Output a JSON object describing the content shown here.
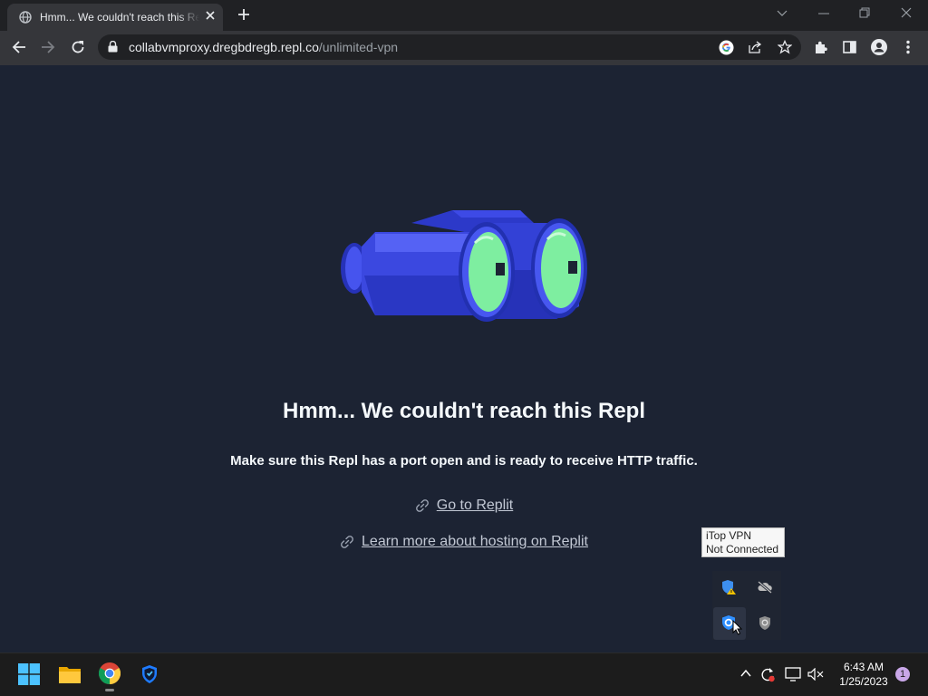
{
  "browser": {
    "tab": {
      "title": "Hmm... We couldn't reach this Repl",
      "favicon": "globe-icon",
      "close_icon": "close-icon"
    },
    "new_tab_icon": "plus-icon",
    "window_controls": [
      "chevron-down-icon",
      "minimize-icon",
      "restore-icon",
      "close-icon"
    ],
    "nav": [
      "back-arrow-icon",
      "forward-arrow-icon",
      "reload-icon"
    ],
    "address": {
      "host": "collabvmproxy.dregbdregb.repl.co",
      "path": "/unlimited-vpn",
      "lock_icon": "lock-icon"
    },
    "address_actions": [
      "google-icon",
      "share-icon",
      "star-icon"
    ],
    "toolbar_actions": [
      "extensions-puzzle-icon",
      "side-panel-icon",
      "profile-icon",
      "kebab-menu-icon"
    ]
  },
  "page": {
    "illustration": "binoculars-illustration",
    "heading": "Hmm... We couldn't reach this Repl",
    "subtitle": "Make sure this Repl has a port open and is ready to receive HTTP traffic.",
    "links": [
      {
        "label": "Go to Replit",
        "icon": "link-icon"
      },
      {
        "label": "Learn more about hosting on Replit",
        "icon": "link-icon"
      }
    ]
  },
  "tray_flyout": {
    "tooltip": {
      "line1": "iTop VPN",
      "line2": "Not Connected"
    },
    "icons": [
      "defender-warning-icon",
      "onedrive-offline-icon",
      "itop-vpn-icon",
      "security-shield-icon"
    ]
  },
  "taskbar": {
    "pinned": [
      "windows-start-icon",
      "file-explorer-icon",
      "chrome-icon",
      "itop-vpn-icon"
    ],
    "tray": [
      "chevron-up-icon",
      "sync-alert-icon",
      "display-icon",
      "volume-muted-icon"
    ],
    "clock": {
      "time": "6:43 AM",
      "date": "1/25/2023"
    },
    "notifications": "1"
  },
  "colors": {
    "page_bg": "#1c2333",
    "binocular_blue": "#3b48e0",
    "lens_green": "#7eeea0",
    "text": "#f5f9fc"
  }
}
